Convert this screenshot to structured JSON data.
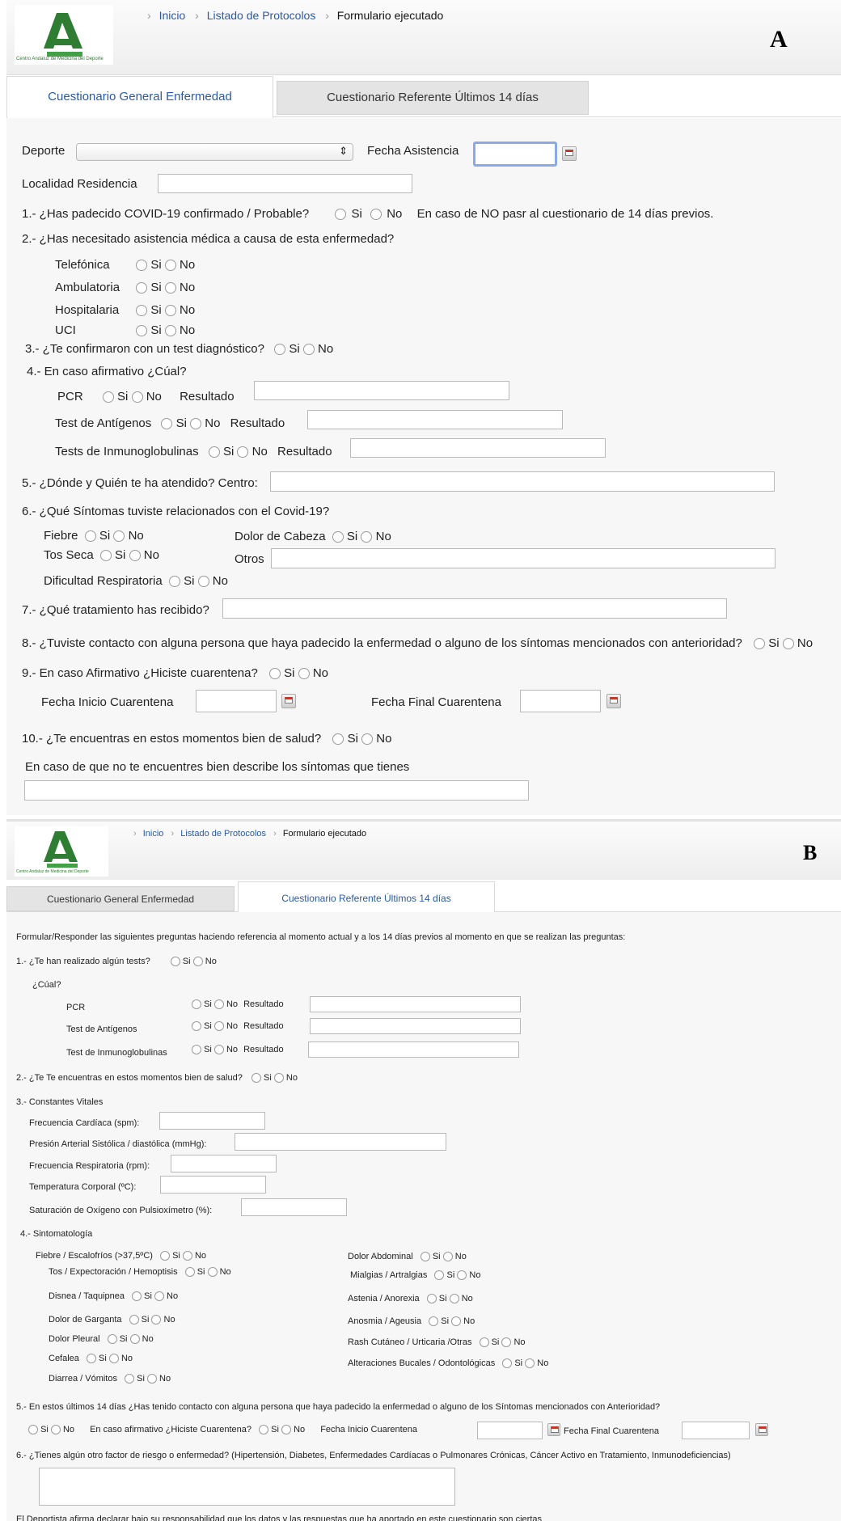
{
  "panel_a": {
    "label": "A",
    "logo_text": "Centro Andaluz de Medicina del Deporte",
    "breadcrumb": [
      "Inicio",
      "Listado de Protocolos",
      "Formulario ejecutado"
    ],
    "tabs": [
      "Cuestionario General Enfermedad",
      "Cuestionario Referente Últimos 14 días"
    ],
    "active_tab": 0,
    "deporte_label": "Deporte",
    "fecha_asistencia_label": "Fecha Asistencia",
    "localidad_label": "Localidad Residencia",
    "si": "Si",
    "no": "No",
    "q1": "1.- ¿Has padecido COVID-19 confirmado / Probable?",
    "q1_note": "En caso de NO pasr al cuestionario de 14 días previos.",
    "q2": "2.- ¿Has necesitado asistencia médica a causa de esta enfermedad?",
    "q2_opts": [
      "Telefónica",
      "Ambulatoria",
      "Hospitalaria",
      "UCI"
    ],
    "q3": "3.- ¿Te confirmaron con un test diagnóstico?",
    "q4": "4.- En caso afirmativo ¿Cúal?",
    "q4_tests": [
      "PCR",
      "Test de Antígenos",
      "Tests de Inmunoglobulinas"
    ],
    "resultado": "Resultado",
    "q5": "5.- ¿Dónde y Quién te ha atendido? Centro:",
    "q6": "6.- ¿Qué Síntomas tuviste relacionados con el Covid-19?",
    "q6_left": [
      "Fiebre",
      "Tos Seca",
      "Dificultad Respiratoria"
    ],
    "q6_dolor": "Dolor de Cabeza",
    "q6_otros": "Otros",
    "q7": "7.- ¿Qué tratamiento has recibido?",
    "q8": "8.- ¿Tuviste contacto con alguna persona que haya padecido la enfermedad o alguno de los síntomas mencionados con anterioridad?",
    "q9": "9.- En caso Afirmativo ¿Hiciste cuarentena?",
    "fecha_inicio": "Fecha Inicio Cuarentena",
    "fecha_final": "Fecha Final Cuarentena",
    "q10": "10.- ¿Te encuentras en estos momentos bien de salud?",
    "q10_desc": "En caso de que no te encuentres bien describe los síntomas que tienes"
  },
  "panel_b": {
    "label": "B",
    "logo_text": "Centro Andaluz de Medicina del Deporte",
    "breadcrumb": [
      "Inicio",
      "Listado de Protocolos",
      "Formulario ejecutado"
    ],
    "tabs": [
      "Cuestionario General Enfermedad",
      "Cuestionario Referente Últimos 14 días"
    ],
    "active_tab": 1,
    "intro": "Formular/Responder las siguientes preguntas haciendo referencia al momento actual y a los 14 días previos al momento en que se realizan las preguntas:",
    "si": "Si",
    "no": "No",
    "q1": "1.- ¿Te han realizado algún tests?",
    "q1_cual": "¿Cúal?",
    "q1_tests": [
      "PCR",
      "Test de Antígenos",
      "Test de Inmunoglobulinas"
    ],
    "resultado": "Resultado",
    "q2": "2.- ¿Te Te encuentras en estos momentos bien de salud?",
    "q3": "3.- Constantes Vitales",
    "vitals": [
      "Frecuencia Cardíaca (spm):",
      "Presión Arterial Sistólica / diastólica (mmHg):",
      "Frecuencia Respiratoria (rpm):",
      "Temperatura Corporal (ºC):",
      "Saturación de Oxígeno con Pulsioxímetro (%):"
    ],
    "q4": "4.- Sintomatología",
    "symptoms_left": [
      "Fiebre / Escalofríos (>37,5ºC)",
      "Tos / Expectoración / Hemoptisis",
      "Disnea / Taquipnea",
      "Dolor de Garganta",
      "Dolor Pleural",
      "Cefalea",
      "Diarrea / Vómitos"
    ],
    "symptoms_right": [
      "Dolor Abdominal",
      "Mialgias / Artralgias",
      "Astenia / Anorexia",
      "Anosmia / Ageusia",
      "Rash Cutáneo / Urticaria /Otras",
      "Alteraciones Bucales / Odontológicas"
    ],
    "q5": "5.- En estos últimos 14 días ¿Has tenido contacto con alguna persona que haya padecido la enfermedad o alguno de los Síntomas mencionados con Anterioridad?",
    "q5_cuarentena": "En caso afirmativo ¿Hiciste Cuarentena?",
    "fecha_inicio": "Fecha Inicio Cuarentena",
    "fecha_final": "Fecha Final Cuarentena",
    "q6": "6.- ¿Tienes algún otro factor de riesgo o enfermedad? (Hipertensión, Diabetes, Enfermedades Cardíacas o Pulmonares Crónicas, Cáncer Activo en Tratamiento, Inmunodeficiencias)",
    "footer": "El Deportista afirma declarar bajo su responsabilidad que los datos y las respuestas que ha aportado en este cuestionario son ciertas"
  }
}
